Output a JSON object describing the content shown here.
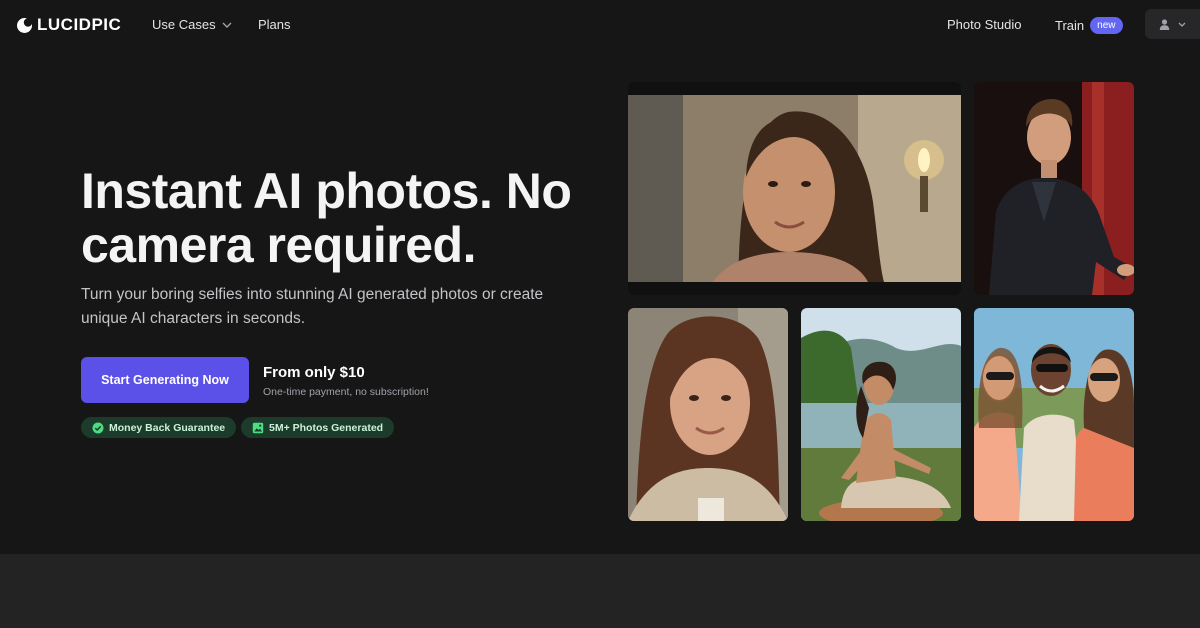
{
  "brand": {
    "name": "LUCIDPIC",
    "logo_icon": "crescent-moon-icon"
  },
  "nav": {
    "use_cases": "Use Cases",
    "plans": "Plans",
    "photo_studio": "Photo Studio",
    "train": "Train",
    "train_badge": "new"
  },
  "hero": {
    "title": "Instant AI photos. No camera required.",
    "subtitle": "Turn your boring selfies into stunning AI generated photos or create unique AI characters in seconds.",
    "cta_label": "Start Generating Now",
    "price": "From only $10",
    "price_note": "One-time payment, no subscription!",
    "badges": [
      {
        "label": "Money Back Guarantee",
        "icon": "check-circle-icon"
      },
      {
        "label": "5M+ Photos Generated",
        "icon": "image-icon"
      }
    ]
  },
  "gallery": [
    {
      "subject": "woman-portrait-lamp"
    },
    {
      "subject": "man-speaking-stage"
    },
    {
      "subject": "woman-closeup-smile"
    },
    {
      "subject": "woman-meditating-lake"
    },
    {
      "subject": "friends-sunglasses"
    }
  ],
  "colors": {
    "background": "#161616",
    "accent": "#5b50e8",
    "badge_green_bg": "#1c3b2b",
    "badge_green_text": "#c9f3d9",
    "new_badge": "#6366f1"
  }
}
